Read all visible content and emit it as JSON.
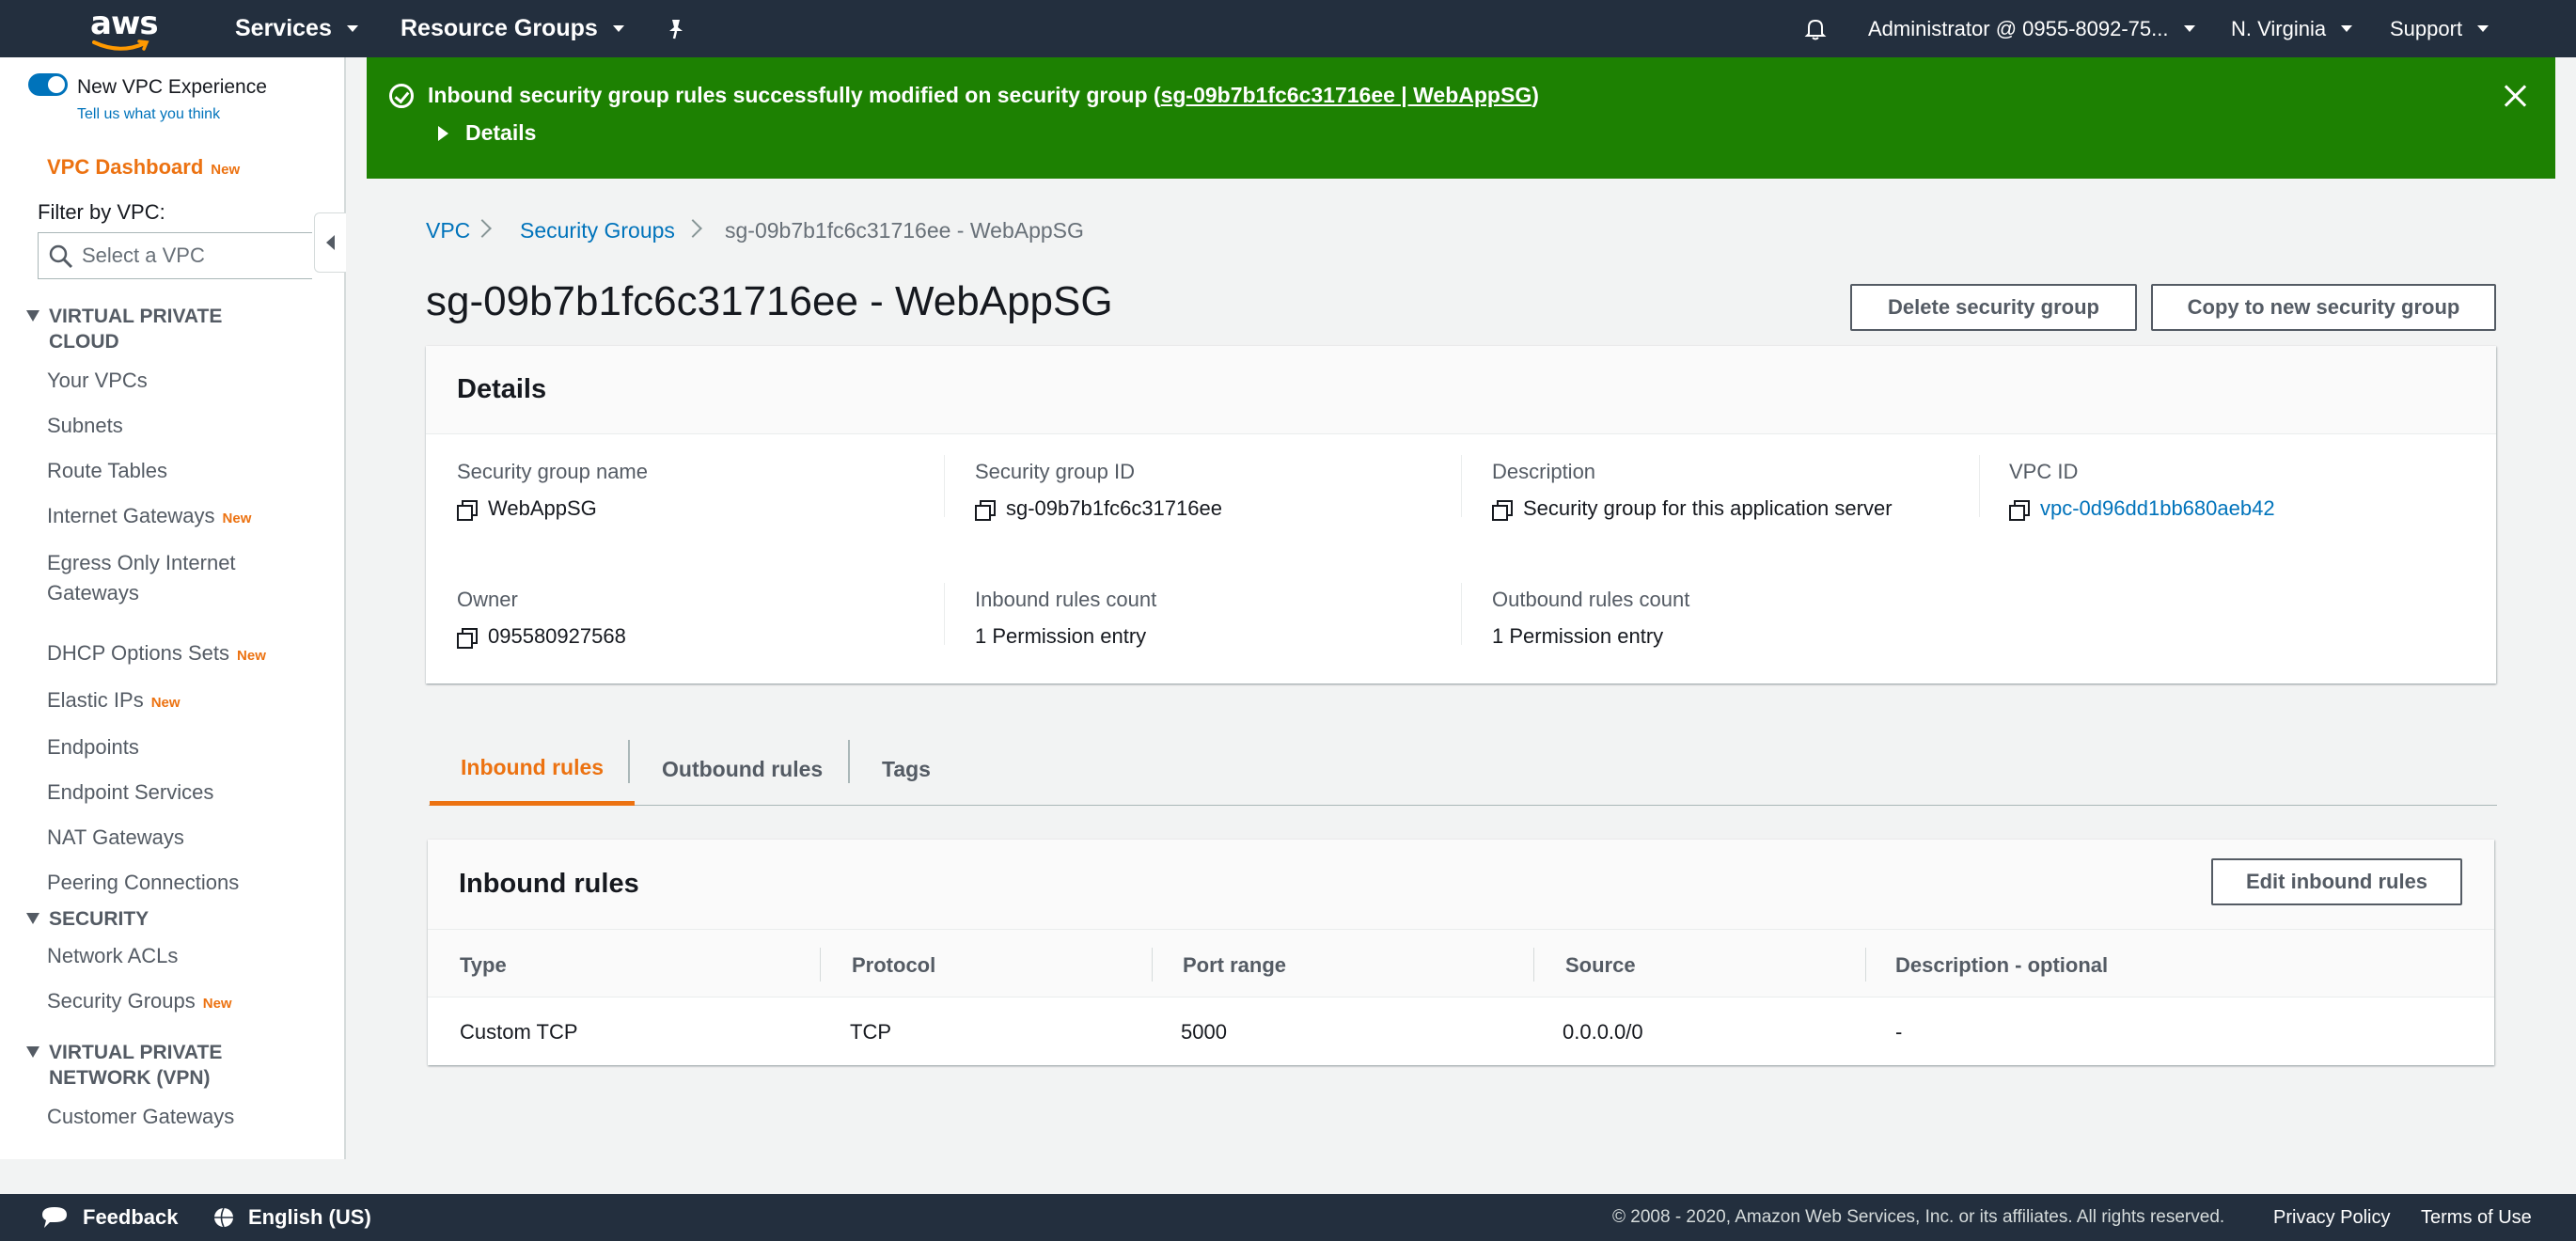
{
  "topnav": {
    "logo_text": "aws",
    "services": "Services",
    "resource_groups": "Resource Groups",
    "account": "Administrator @ 0955-8092-75...",
    "region": "N. Virginia",
    "support": "Support"
  },
  "sidebar": {
    "new_vpc_experience": "New VPC Experience",
    "tell_us": "Tell us what you think",
    "dashboard": "VPC Dashboard",
    "new_badge": "New",
    "filter_label": "Filter by VPC:",
    "filter_placeholder": "Select a VPC",
    "section_vpc_line1": "VIRTUAL PRIVATE",
    "section_vpc_line2": "CLOUD",
    "items_vpc": [
      {
        "label": "Your VPCs",
        "new": ""
      },
      {
        "label": "Subnets",
        "new": ""
      },
      {
        "label": "Route Tables",
        "new": ""
      },
      {
        "label": "Internet Gateways",
        "new": "New"
      },
      {
        "label_line1": "Egress Only Internet",
        "label_line2": "Gateways",
        "new": ""
      },
      {
        "label": "DHCP Options Sets",
        "new": "New"
      },
      {
        "label": "Elastic IPs",
        "new": "New"
      },
      {
        "label": "Endpoints",
        "new": ""
      },
      {
        "label": "Endpoint Services",
        "new": ""
      },
      {
        "label": "NAT Gateways",
        "new": ""
      },
      {
        "label": "Peering Connections",
        "new": ""
      }
    ],
    "section_security": "SECURITY",
    "items_security": [
      {
        "label": "Network ACLs",
        "new": ""
      },
      {
        "label": "Security Groups",
        "new": "New"
      }
    ],
    "section_vpn_line1": "VIRTUAL PRIVATE",
    "section_vpn_line2": "NETWORK (VPN)",
    "items_vpn": [
      {
        "label": "Customer Gateways",
        "new": ""
      }
    ]
  },
  "flash": {
    "message": "Inbound security group rules successfully modified on security group (",
    "link": "sg-09b7b1fc6c31716ee | WebAppSG",
    "message_end": ")",
    "details": "Details",
    "color": "#1d8102"
  },
  "breadcrumb": {
    "vpc": "VPC",
    "security_groups": "Security Groups",
    "current": "sg-09b7b1fc6c31716ee - WebAppSG"
  },
  "page": {
    "title": "sg-09b7b1fc6c31716ee - WebAppSG",
    "delete_button": "Delete security group",
    "copy_button": "Copy to new security group"
  },
  "details": {
    "heading": "Details",
    "sg_name_label": "Security group name",
    "sg_name": "WebAppSG",
    "sg_id_label": "Security group ID",
    "sg_id": "sg-09b7b1fc6c31716ee",
    "description_label": "Description",
    "description": "Security group for this application server",
    "vpc_id_label": "VPC ID",
    "vpc_id": "vpc-0d96dd1bb680aeb42",
    "owner_label": "Owner",
    "owner": "095580927568",
    "inbound_count_label": "Inbound rules count",
    "inbound_count": "1 Permission entry",
    "outbound_count_label": "Outbound rules count",
    "outbound_count": "1 Permission entry"
  },
  "tabs": {
    "inbound": "Inbound rules",
    "outbound": "Outbound rules",
    "tags": "Tags"
  },
  "inbound_rules": {
    "heading": "Inbound rules",
    "edit_button": "Edit inbound rules",
    "columns": [
      "Type",
      "Protocol",
      "Port range",
      "Source",
      "Description - optional"
    ],
    "rows": [
      [
        "Custom TCP",
        "TCP",
        "5000",
        "0.0.0.0/0",
        "-"
      ]
    ]
  },
  "footer": {
    "feedback": "Feedback",
    "language": "English (US)",
    "copyright": "© 2008 - 2020, Amazon Web Services, Inc. or its affiliates. All rights reserved.",
    "privacy": "Privacy Policy",
    "terms": "Terms of Use"
  },
  "colors": {
    "nav_bg": "#232f3e",
    "accent": "#ec7211",
    "link": "#0073bb"
  }
}
